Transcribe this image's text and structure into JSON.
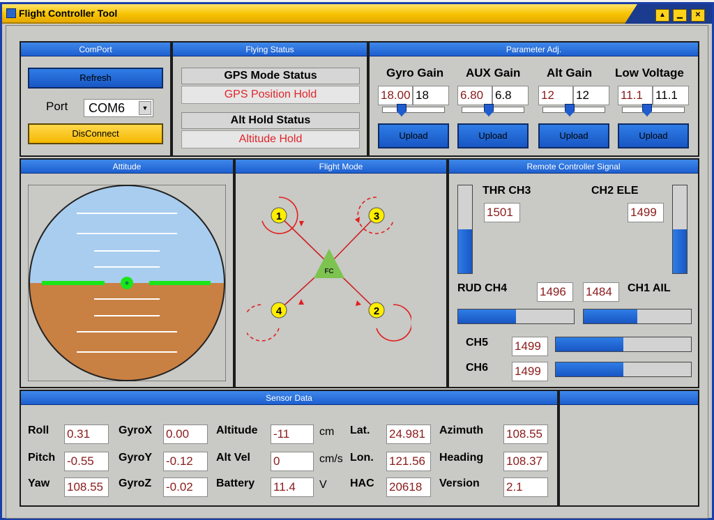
{
  "window": {
    "title": "Flight Controller Tool",
    "buttons": [
      "▲",
      "▁",
      "✕"
    ]
  },
  "comport": {
    "header": "ComPort",
    "refresh_label": "Refresh",
    "port_label": "Port",
    "port_value": "COM6",
    "disconnect_label": "DisConnect"
  },
  "flying_status": {
    "header": "Flying Status",
    "gps_title": "GPS Mode Status",
    "gps_value": "GPS Position Hold",
    "alt_title": "Alt Hold Status",
    "alt_value": "Altitude Hold"
  },
  "params": {
    "header": "Parameter Adj.",
    "upload_label": "Upload",
    "items": [
      {
        "label": "Gyro Gain",
        "current": "18.00",
        "input": "18",
        "level": 0.27
      },
      {
        "label": "AUX Gain",
        "current": "6.80",
        "input": "6.8",
        "level": 0.42
      },
      {
        "label": "Alt Gain",
        "current": "12",
        "input": "12",
        "level": 0.42
      },
      {
        "label": "Low Voltage",
        "current": "11.1",
        "input": "11.1",
        "level": 0.38
      }
    ]
  },
  "attitude": {
    "header": "Attitude"
  },
  "flight_mode": {
    "header": "Flight Mode",
    "center_label": "FC",
    "motors": [
      "1",
      "2",
      "3",
      "4"
    ]
  },
  "rc": {
    "header": "Remote Controller Signal",
    "thr_label": "THR CH3",
    "thr_value": "1501",
    "thr_level": 0.5,
    "ele_label": "CH2 ELE",
    "ele_value": "1499",
    "ele_level": 0.5,
    "rud_label": "RUD CH4",
    "rud_value": "1496",
    "rud_level": 0.5,
    "ail_label": "CH1 AIL",
    "ail_value": "1484",
    "ail_level": 0.5,
    "ch5_label": "CH5",
    "ch5_value": "1499",
    "ch5_level": 0.5,
    "ch6_label": "CH6",
    "ch6_value": "1499",
    "ch6_level": 0.5
  },
  "sensor": {
    "header": "Sensor Data",
    "roll_label": "Roll",
    "roll": "0.31",
    "pitch_label": "Pitch",
    "pitch": "-0.55",
    "yaw_label": "Yaw",
    "yaw": "108.55",
    "gyrox_label": "GyroX",
    "gyrox": "0.00",
    "gyroy_label": "GyroY",
    "gyroy": "-0.12",
    "gyroz_label": "GyroZ",
    "gyroz": "-0.02",
    "altitude_label": "Altitude",
    "altitude": "-11",
    "altitude_unit": "cm",
    "altvel_label": "Alt Vel",
    "altvel": "0",
    "altvel_unit": "cm/s",
    "battery_label": "Battery",
    "battery": "11.4",
    "battery_unit": "V",
    "lat_label": "Lat.",
    "lat": "24.981",
    "lon_label": "Lon.",
    "lon": "121.56",
    "hac_label": "HAC",
    "hac": "20618",
    "azimuth_label": "Azimuth",
    "azimuth": "108.55",
    "heading_label": "Heading",
    "heading": "108.37",
    "version_label": "Version",
    "version": "2.1"
  },
  "colors": {
    "sky": "#a8cdef",
    "ground": "#c98043",
    "horizon": "#19e619",
    "rotor_arrow": "#e02020",
    "fc_triangle": "#7cc44f"
  }
}
